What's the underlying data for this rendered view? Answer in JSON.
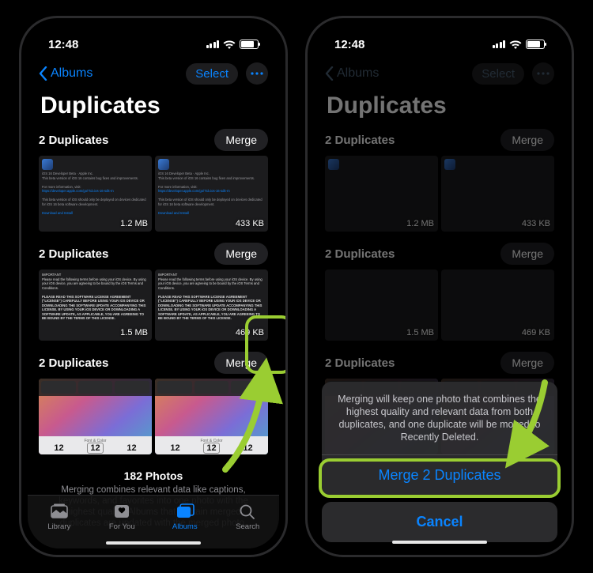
{
  "status": {
    "time": "12:48"
  },
  "nav": {
    "back_label": "Albums",
    "select_label": "Select",
    "title": "Duplicates"
  },
  "groups": [
    {
      "title": "2 Duplicates",
      "merge_label": "Merge",
      "thumbs": [
        {
          "size": "1.2 MB"
        },
        {
          "size": "433 KB"
        }
      ]
    },
    {
      "title": "2 Duplicates",
      "merge_label": "Merge",
      "thumbs": [
        {
          "size": "1.5 MB"
        },
        {
          "size": "469 KB"
        }
      ]
    },
    {
      "title": "2 Duplicates",
      "merge_label": "Merge",
      "thumbs": [
        {
          "font_label": "Font & Color",
          "nums": [
            "12",
            "12",
            "12"
          ]
        },
        {
          "font_label": "Font & Color",
          "nums": [
            "12",
            "12",
            "12"
          ]
        }
      ]
    }
  ],
  "footer": {
    "count": "182 Photos",
    "description": "Merging combines relevant data like captions, keywords, and favorites into one photo with the highest quality. Albums that contain merged duplicates are updated with the merged photo."
  },
  "tabs": {
    "library": "Library",
    "for_you": "For You",
    "albums": "Albums",
    "search": "Search"
  },
  "sheet": {
    "message": "Merging will keep one photo that combines the highest quality and relevant data from both duplicates, and one duplicate will be moved to Recently Deleted.",
    "action": "Merge 2 Duplicates",
    "cancel": "Cancel"
  }
}
